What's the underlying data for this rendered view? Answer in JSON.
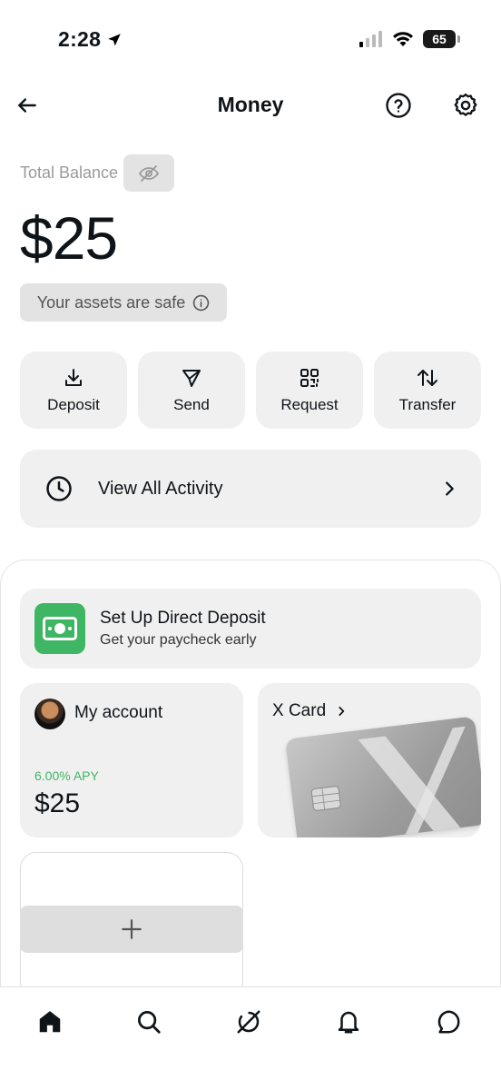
{
  "status_bar": {
    "time": "2:28",
    "battery": "65"
  },
  "header": {
    "title": "Money"
  },
  "balance": {
    "label": "Total Balance",
    "amount": "$25",
    "safe_text": "Your assets are safe"
  },
  "actions": [
    {
      "label": "Deposit",
      "icon": "download-icon"
    },
    {
      "label": "Send",
      "icon": "send-icon"
    },
    {
      "label": "Request",
      "icon": "qr-code-icon"
    },
    {
      "label": "Transfer",
      "icon": "transfer-icon"
    }
  ],
  "activity": {
    "label": "View All Activity"
  },
  "direct_deposit": {
    "title": "Set Up Direct Deposit",
    "subtitle": "Get your paycheck early"
  },
  "account": {
    "title": "My account",
    "apy": "6.00% APY",
    "balance": "$25"
  },
  "xcard": {
    "title": "X Card"
  },
  "tabbar": [
    "home-icon",
    "search-icon",
    "grok-icon",
    "bell-icon",
    "messages-icon"
  ],
  "colors": {
    "accent_green": "#3fb663",
    "card_bg": "#f0f0f0",
    "text": "#0f1419"
  }
}
